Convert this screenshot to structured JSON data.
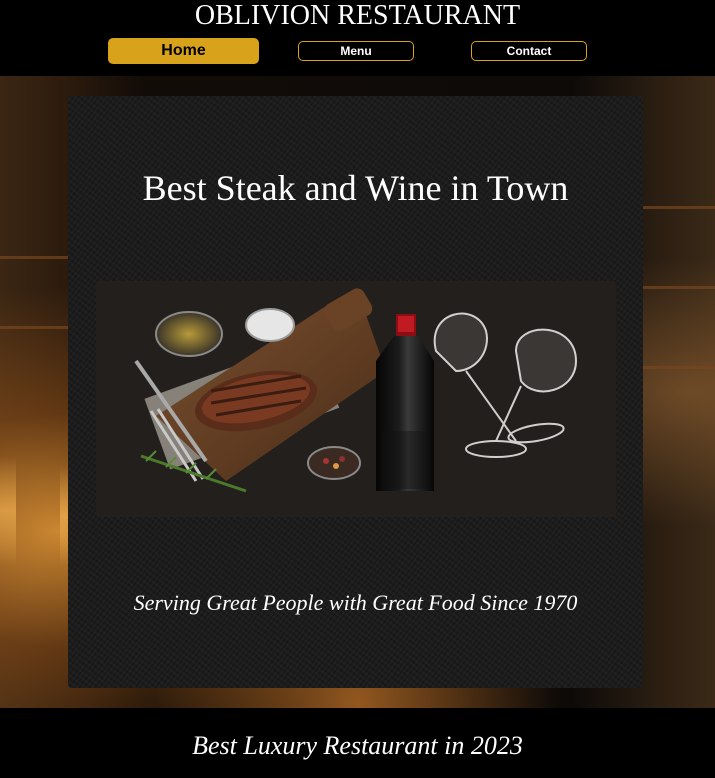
{
  "header": {
    "title": "OBLIVION RESTAURANT",
    "nav": [
      {
        "label": "Home",
        "active": true
      },
      {
        "label": "Menu",
        "active": false
      },
      {
        "label": "Contact",
        "active": false
      }
    ]
  },
  "main": {
    "headline": "Best Steak and Wine in Town",
    "image_icon": "steak-and-wine-photo",
    "tagline": "Serving Great People with Great Food Since 1970"
  },
  "footer": {
    "text": "Best Luxury Restaurant in 2023"
  },
  "colors": {
    "accent": "#d9a21b",
    "background": "#000000",
    "panel": "#1c1c1c",
    "text": "#ffffff"
  }
}
